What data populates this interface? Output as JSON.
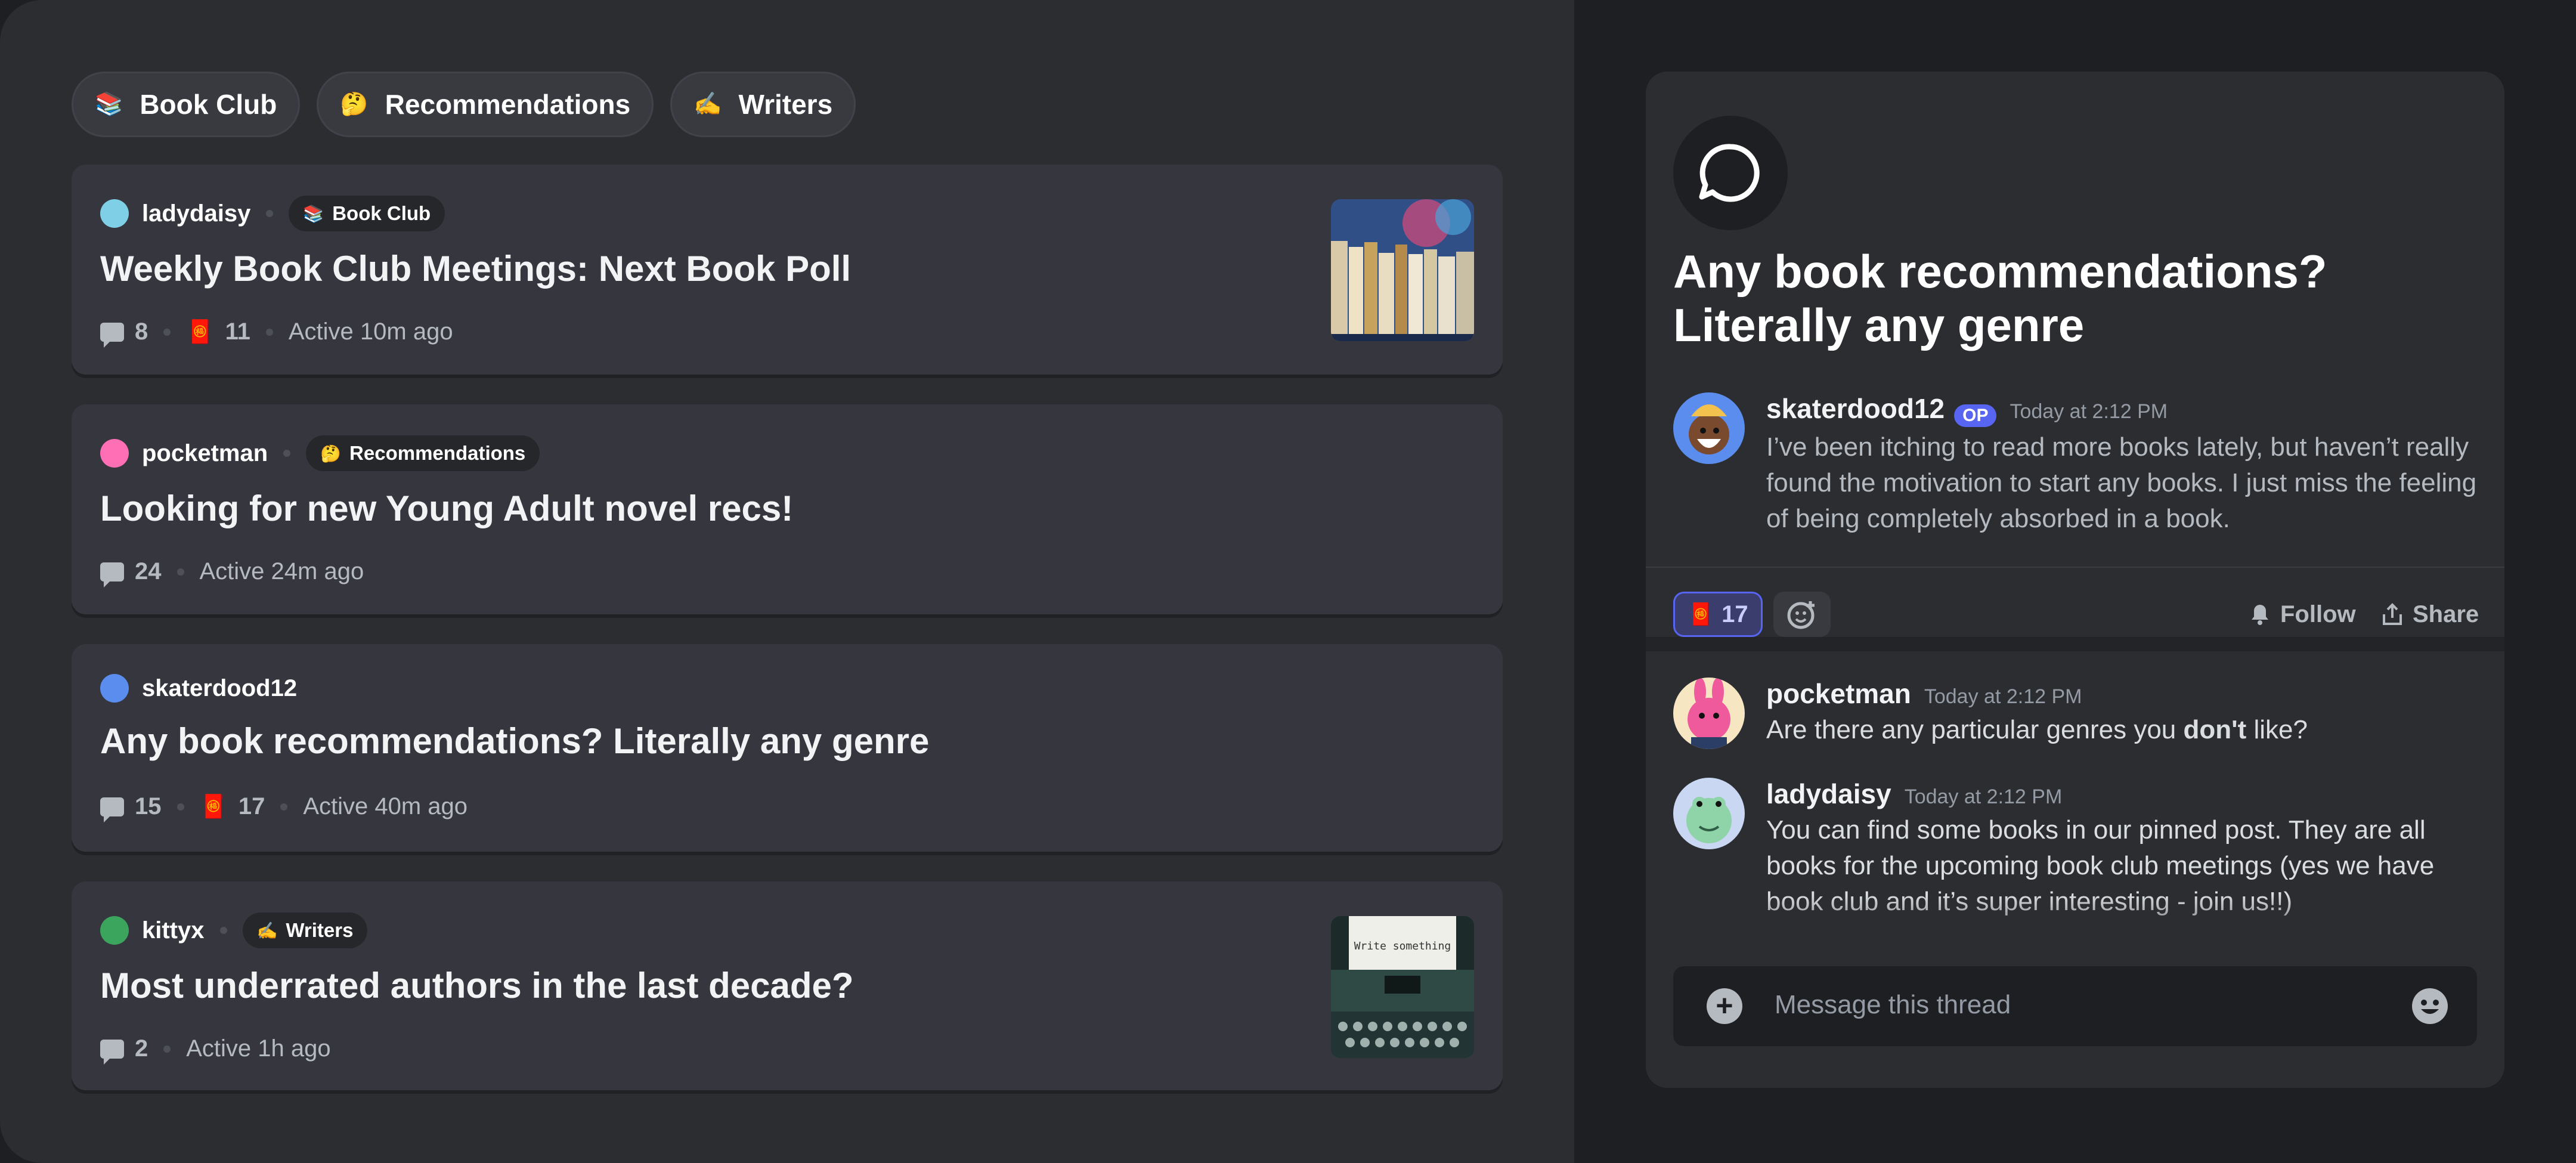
{
  "tags": [
    {
      "emoji": "📚",
      "label": "Book Club"
    },
    {
      "emoji": "🤔",
      "label": "Recommendations"
    },
    {
      "emoji": "✍️",
      "label": "Writers"
    }
  ],
  "posts": [
    {
      "author": "ladydaisy",
      "tag_emoji": "📚",
      "tag": "Book Club",
      "title": "Weekly Book Club Meetings: Next Book Poll",
      "comments": "8",
      "reaction_emoji": "🧧",
      "reactions": "11",
      "activity": "Active 10m ago",
      "thumbnail": "bookshelf"
    },
    {
      "author": "pocketman",
      "tag_emoji": "🤔",
      "tag": "Recommendations",
      "title": "Looking for new Young Adult novel recs!",
      "comments": "24",
      "activity": "Active 24m ago"
    },
    {
      "author": "skaterdood12",
      "title": "Any book recommendations? Literally any genre",
      "comments": "15",
      "reaction_emoji": "🧧",
      "reactions": "17",
      "activity": "Active 40m ago"
    },
    {
      "author": "kittyx",
      "tag_emoji": "✍️",
      "tag": "Writers",
      "title": "Most underrated authors in the last decade?",
      "comments": "2",
      "activity": "Active 1h ago",
      "thumbnail": "typewriter",
      "thumbnail_text": "Write something"
    }
  ],
  "thread": {
    "title": "Any book recommendations? Literally any genre",
    "original": {
      "author": "skaterdood12",
      "badge": "OP",
      "time": "Today at 2:12 PM",
      "text": "I’ve been itching to read more books lately, but haven’t really found the motivation to start any books. I just miss the feeling of being completely absorbed in a book."
    },
    "reaction": {
      "emoji": "🧧",
      "count": "17"
    },
    "follow_label": "Follow",
    "share_label": "Share",
    "replies": [
      {
        "author": "pocketman",
        "time": "Today at 2:12 PM",
        "text_before": "Are there any particular genres you ",
        "text_bold": "don't",
        "text_after": " like?"
      },
      {
        "author": "ladydaisy",
        "time": "Today at 2:12 PM",
        "text": "You can find some books in our pinned post. They are all books for the upcoming book club meetings (yes we have book club and it’s super interesting - join us!!)"
      }
    ],
    "composer_placeholder": "Message this thread"
  },
  "colors": {
    "accent": "#5865f2",
    "card": "#36373e",
    "background": "#2b2d31"
  }
}
